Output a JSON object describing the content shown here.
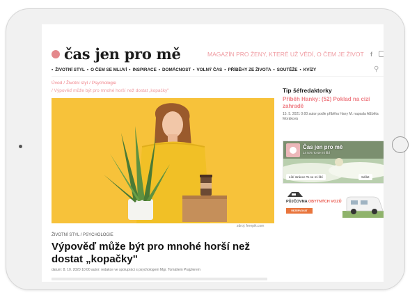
{
  "site": {
    "logo_text": "čas jen pro mě",
    "tagline": "MAGAZÍN PRO ŽENY, KTERÉ UŽ VĚDÍ, O ČEM JE ŽIVOT",
    "fb_icon": "f"
  },
  "nav": {
    "items": [
      {
        "label": "ŽIVOTNÍ STYL"
      },
      {
        "label": "O ČEM SE MLUVÍ"
      },
      {
        "label": "INSPIRACE"
      },
      {
        "label": "DOMÁCNOST"
      },
      {
        "label": "VOLNÝ ČAS"
      },
      {
        "label": "PŘÍBĚHY ZE ŽIVOTA"
      },
      {
        "label": "SOUTĚŽE"
      },
      {
        "label": "KVÍZY"
      }
    ]
  },
  "breadcrumb": {
    "home": "Úvod",
    "section": "Životní styl",
    "subsection": "Psychologie",
    "current": "Výpověď může být pro mnohé horší než dostat „kopačky\""
  },
  "article": {
    "photo_credit": "zdroj: freepik.com",
    "category": "ŽIVOTNÍ STYL / PSYCHOLOGIE",
    "title": "Výpověď může být pro mnohé horší než dostat „kopačky\"",
    "meta": "datum: 8. 10. 2020 10:00 autor: redakce ve spolupráci s psychologem Mgr. Tomášem Prajzlerem"
  },
  "sidebar": {
    "tip_heading": "Tip šéfredaktorky",
    "tip_title": "Příběh Hanky: (52) Poklad na cizí zahradě",
    "tip_meta": "15. 5. 2021 0:00 autor podle příběhu Hany M. napsala Alžběta Moráková",
    "fb_page_name": "Čas jen pro mě",
    "fb_likes": "14 575 To se mi líbí",
    "fb_like_label": "Líbí stránce To se mi líbí",
    "fb_share_label": "Sdílet",
    "ad_text_prefix": "PŮJČOVNA",
    "ad_text_red": "OBYTNÝCH VOZŮ",
    "ad_button": "REZERVOVAT"
  },
  "colors": {
    "brand_pink": "#ef7f86",
    "hero_yellow": "#f7c23a"
  }
}
